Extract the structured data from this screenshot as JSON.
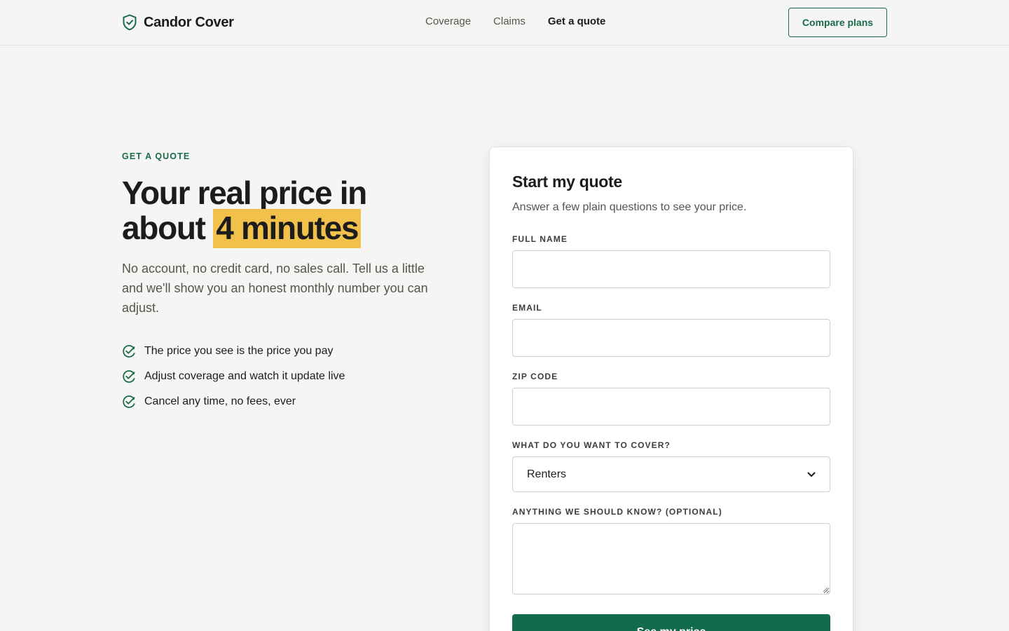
{
  "brand": {
    "name": "Candor Cover",
    "logo_icon": "shield-check-icon",
    "accent_color": "#1a6b4c",
    "highlight_color": "#f2c14b"
  },
  "nav": {
    "items": [
      {
        "label": "Coverage",
        "active": false
      },
      {
        "label": "Claims",
        "active": false
      },
      {
        "label": "Get a quote",
        "active": true
      }
    ],
    "cta_label": "Compare plans"
  },
  "hero": {
    "eyebrow": "GET A QUOTE",
    "title_line1": "Your real price in",
    "title_line2_prefix": "about",
    "title_highlight": "4 minutes",
    "subtitle": "No account, no credit card, no sales call. Tell us a little and we'll show you an honest monthly number you can adjust.",
    "bullets": [
      {
        "icon": "check-circle-icon",
        "text": "The price you see is the price you pay"
      },
      {
        "icon": "check-circle-icon",
        "text": "Adjust coverage and watch it update live"
      },
      {
        "icon": "check-circle-icon",
        "text": "Cancel any time, no fees, ever"
      }
    ]
  },
  "form": {
    "title": "Start my quote",
    "subtitle": "Answer a few plain questions to see your price.",
    "fields": {
      "full_name": {
        "label": "FULL NAME",
        "value": "",
        "placeholder": ""
      },
      "email": {
        "label": "EMAIL",
        "value": "",
        "placeholder": ""
      },
      "zip": {
        "label": "ZIP CODE",
        "value": "",
        "placeholder": ""
      },
      "cover": {
        "label": "WHAT DO YOU WANT TO COVER?",
        "selected": "Renters"
      },
      "notes": {
        "label": "ANYTHING WE SHOULD KNOW? (OPTIONAL)",
        "value": "",
        "placeholder": ""
      }
    },
    "submit_label": "See my price"
  }
}
